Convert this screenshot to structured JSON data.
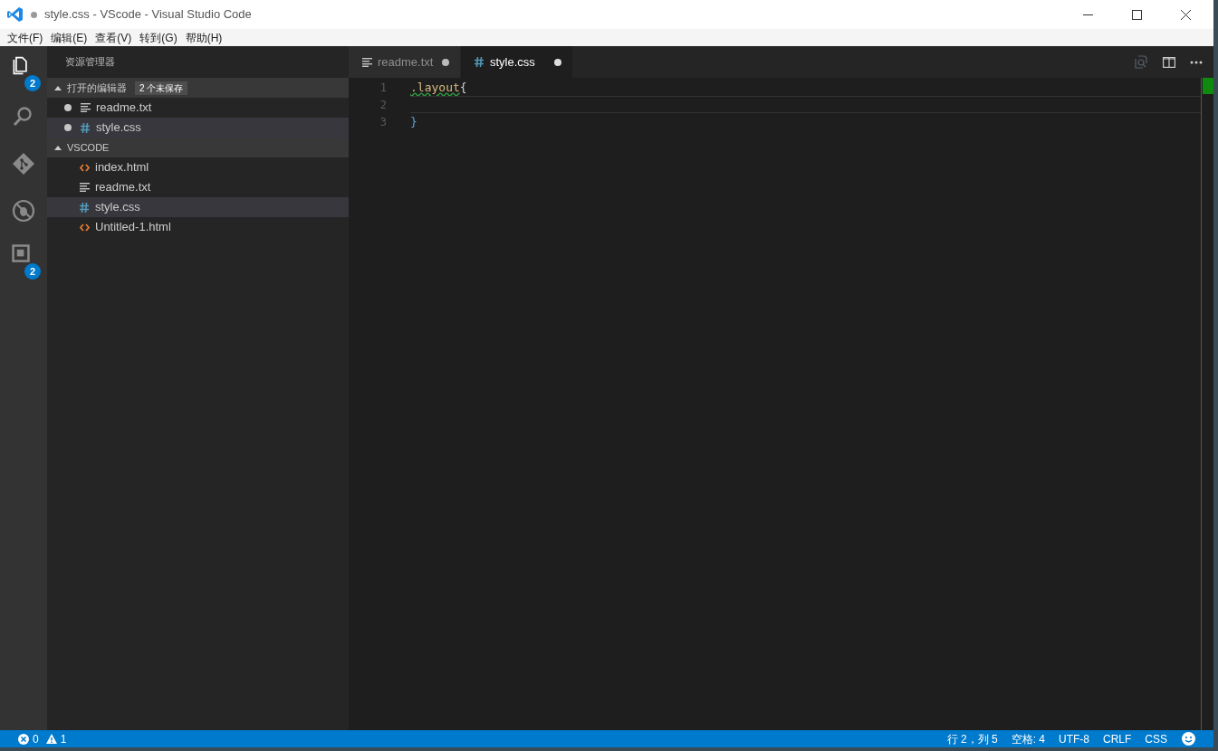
{
  "window": {
    "title": "style.css - VScode - Visual Studio Code",
    "dirty": true
  },
  "menu": [
    "文件(F)",
    "编辑(E)",
    "查看(V)",
    "转到(G)",
    "帮助(H)"
  ],
  "activity_bar": [
    {
      "kind": "files",
      "selected": true,
      "badge": "2"
    },
    {
      "kind": "search",
      "selected": false
    },
    {
      "kind": "git",
      "selected": false
    },
    {
      "kind": "debug",
      "selected": false
    },
    {
      "kind": "extensions",
      "selected": false,
      "badge": "2"
    }
  ],
  "sidebar": {
    "title": "资源管理器",
    "sections": [
      {
        "label": "打开的编辑器",
        "badge": "2 个未保存",
        "expanded": true,
        "items": [
          {
            "name": "readme.txt",
            "kind": "txt",
            "dirty": true,
            "selected": false
          },
          {
            "name": "style.css",
            "kind": "css",
            "dirty": true,
            "selected": true
          }
        ]
      },
      {
        "label": "VSCODE",
        "expanded": true,
        "items": [
          {
            "name": "index.html",
            "kind": "html",
            "selected": false
          },
          {
            "name": "readme.txt",
            "kind": "txt",
            "selected": false
          },
          {
            "name": "style.css",
            "kind": "css",
            "selected": true
          },
          {
            "name": "Untitled-1.html",
            "kind": "html",
            "selected": false
          }
        ]
      }
    ]
  },
  "tabs": [
    {
      "label": "readme.txt",
      "kind": "txt",
      "dirty": true,
      "selected": false
    },
    {
      "label": "style.css",
      "kind": "css",
      "dirty": true,
      "selected": true
    }
  ],
  "editor": {
    "lines": [
      {
        "number": "1",
        "current": false,
        "tokens": [
          {
            "text": ".layout",
            "kind": "selector",
            "warning": true
          },
          {
            "text": "{",
            "kind": "punct"
          }
        ]
      },
      {
        "number": "2",
        "current": true
      },
      {
        "number": "3",
        "current": false,
        "tokens": [
          {
            "text": "}",
            "kind": "brace"
          }
        ]
      }
    ]
  },
  "status_bar": {
    "errors": "0",
    "warnings": "1",
    "items": [
      "行 2，列 5",
      "空格: 4",
      "UTF-8",
      "CRLF",
      "CSS"
    ]
  }
}
